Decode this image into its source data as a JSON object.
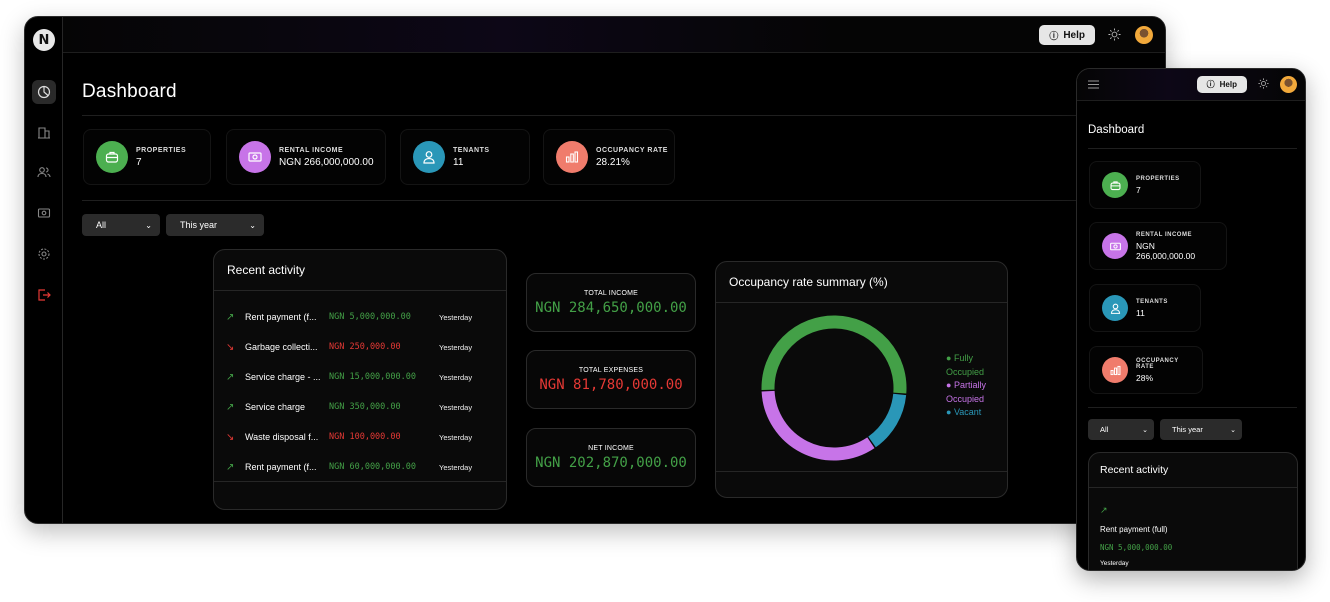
{
  "header": {
    "help_label": "Help"
  },
  "page": {
    "title": "Dashboard"
  },
  "stats": [
    {
      "label": "PROPERTIES",
      "value": "7",
      "color": "#4caf50",
      "icon": "briefcase-icon"
    },
    {
      "label": "RENTAL INCOME",
      "value": "NGN 266,000,000.00",
      "color": "#c774e8",
      "icon": "money-icon"
    },
    {
      "label": "TENANTS",
      "value": "11",
      "color": "#2a97b8",
      "icon": "user-icon"
    },
    {
      "label": "OCCUPANCY RATE",
      "value": "28.21%",
      "color": "#f07c6c",
      "icon": "bar-chart-icon"
    }
  ],
  "filters": {
    "category": "All",
    "period": "This year"
  },
  "recent_activity": {
    "title": "Recent activity",
    "rows": [
      {
        "name": "Rent payment (f...",
        "amount": "NGN 5,000,000.00",
        "when": "Yesterday",
        "direction": "up"
      },
      {
        "name": "Garbage collecti...",
        "amount": "NGN 250,000.00",
        "when": "Yesterday",
        "direction": "down"
      },
      {
        "name": "Service charge - ...",
        "amount": "NGN 15,000,000.00",
        "when": "Yesterday",
        "direction": "up"
      },
      {
        "name": "Service charge",
        "amount": "NGN 350,000.00",
        "when": "Yesterday",
        "direction": "up"
      },
      {
        "name": "Waste disposal f...",
        "amount": "NGN 100,000.00",
        "when": "Yesterday",
        "direction": "down"
      },
      {
        "name": "Rent payment (f...",
        "amount": "NGN 60,000,000.00",
        "when": "Yesterday",
        "direction": "up"
      }
    ]
  },
  "totals": {
    "income": {
      "label": "TOTAL INCOME",
      "value": "NGN 284,650,000.00"
    },
    "expenses": {
      "label": "TOTAL EXPENSES",
      "value": "NGN 81,780,000.00"
    },
    "net": {
      "label": "NET INCOME",
      "value": "NGN 202,870,000.00"
    }
  },
  "occupancy": {
    "title": "Occupancy rate summary (%)",
    "legend": [
      {
        "label": "Fully Occupied",
        "color": "#43a047"
      },
      {
        "label": "Partially Occupied",
        "color": "#c774e8"
      },
      {
        "label": "Vacant",
        "color": "#2a97b8"
      }
    ]
  },
  "chart_data": {
    "type": "pie",
    "title": "Occupancy rate summary (%)",
    "categories": [
      "Fully Occupied",
      "Partially Occupied",
      "Vacant"
    ],
    "values": [
      52,
      34,
      14
    ],
    "colors": [
      "#43a047",
      "#c774e8",
      "#2a97b8"
    ],
    "legend": "right"
  },
  "mobile": {
    "title": "Dashboard",
    "stats": [
      {
        "label": "PROPERTIES",
        "value": "7"
      },
      {
        "label": "RENTAL INCOME",
        "value": "NGN 266,000,000.00"
      },
      {
        "label": "TENANTS",
        "value": "11"
      },
      {
        "label": "OCCUPANCY RATE",
        "value": "28%"
      }
    ],
    "activity_item": {
      "name": "Rent payment (full)",
      "amount": "NGN 5,000,000.00",
      "when": "Yesterday"
    }
  }
}
